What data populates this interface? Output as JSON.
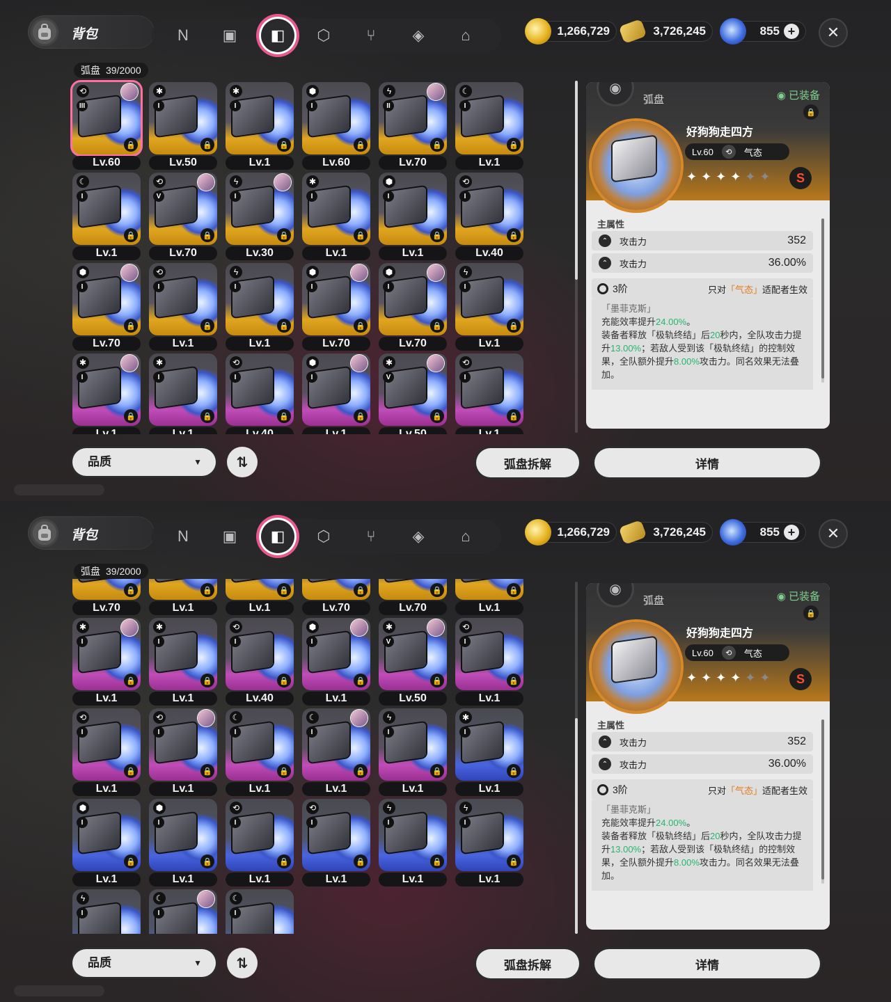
{
  "header": {
    "title": "背包",
    "nav_icons": [
      "n-logo-icon",
      "gameboy-icon",
      "disc-drive-icon",
      "cube-icon",
      "utensils-icon",
      "book-icon",
      "home-icon"
    ],
    "active_index": 2
  },
  "currencies": [
    {
      "name": "gold-coin-icon",
      "value": "1,266,729"
    },
    {
      "name": "ticket-icon",
      "value": "3,726,245"
    },
    {
      "name": "polychrome-icon",
      "value": "855"
    }
  ],
  "inventory": {
    "label": "弧盘",
    "count": "39/2000"
  },
  "panel1": {
    "cards": [
      {
        "lv": "Lv.60",
        "rank": "III",
        "frame": "gold",
        "attr": "⟲",
        "avatar": true,
        "selected": true
      },
      {
        "lv": "Lv.50",
        "rank": "I",
        "frame": "gold",
        "attr": "✱",
        "avatar": false
      },
      {
        "lv": "Lv.1",
        "rank": "I",
        "frame": "gold",
        "attr": "✱",
        "avatar": false
      },
      {
        "lv": "Lv.60",
        "rank": "I",
        "frame": "gold",
        "attr": "⬢",
        "avatar": false
      },
      {
        "lv": "Lv.70",
        "rank": "II",
        "frame": "gold",
        "attr": "ϟ",
        "avatar": true
      },
      {
        "lv": "Lv.1",
        "rank": "I",
        "frame": "gold",
        "attr": "☾",
        "avatar": false
      },
      {
        "lv": "Lv.1",
        "rank": "I",
        "frame": "gold",
        "attr": "☾",
        "avatar": false
      },
      {
        "lv": "Lv.70",
        "rank": "V",
        "frame": "gold",
        "attr": "⟲",
        "avatar": true
      },
      {
        "lv": "Lv.30",
        "rank": "I",
        "frame": "gold",
        "attr": "ϟ",
        "avatar": true
      },
      {
        "lv": "Lv.1",
        "rank": "I",
        "frame": "gold",
        "attr": "✱",
        "avatar": false
      },
      {
        "lv": "Lv.1",
        "rank": "I",
        "frame": "gold",
        "attr": "⬢",
        "avatar": false
      },
      {
        "lv": "Lv.40",
        "rank": "I",
        "frame": "gold",
        "attr": "⟲",
        "avatar": false
      },
      {
        "lv": "Lv.70",
        "rank": "I",
        "frame": "gold",
        "attr": "⬢",
        "avatar": true
      },
      {
        "lv": "Lv.1",
        "rank": "I",
        "frame": "gold",
        "attr": "⟲",
        "avatar": false
      },
      {
        "lv": "Lv.1",
        "rank": "I",
        "frame": "gold",
        "attr": "ϟ",
        "avatar": false
      },
      {
        "lv": "Lv.70",
        "rank": "I",
        "frame": "gold",
        "attr": "⬢",
        "avatar": true
      },
      {
        "lv": "Lv.70",
        "rank": "I",
        "frame": "gold",
        "attr": "⬢",
        "avatar": true
      },
      {
        "lv": "Lv.1",
        "rank": "I",
        "frame": "gold",
        "attr": "ϟ",
        "avatar": false
      },
      {
        "lv": "Lv.1",
        "rank": "I",
        "frame": "purple",
        "attr": "✱",
        "avatar": true
      },
      {
        "lv": "Lv.1",
        "rank": "I",
        "frame": "purple",
        "attr": "✱",
        "avatar": false
      },
      {
        "lv": "Lv.40",
        "rank": "I",
        "frame": "purple",
        "attr": "⟲",
        "avatar": false
      },
      {
        "lv": "Lv.1",
        "rank": "I",
        "frame": "purple",
        "attr": "⬢",
        "avatar": true
      },
      {
        "lv": "Lv.50",
        "rank": "V",
        "frame": "purple",
        "attr": "✱",
        "avatar": true
      },
      {
        "lv": "Lv.1",
        "rank": "I",
        "frame": "purple",
        "attr": "⟲",
        "avatar": false
      }
    ]
  },
  "panel2": {
    "cards": [
      {
        "lv": "Lv.70",
        "rank": "I",
        "frame": "gold",
        "attr": "⬢",
        "avatar": false
      },
      {
        "lv": "Lv.1",
        "rank": "I",
        "frame": "gold",
        "attr": "⟲",
        "avatar": false
      },
      {
        "lv": "Lv.1",
        "rank": "I",
        "frame": "gold",
        "attr": "ϟ",
        "avatar": false
      },
      {
        "lv": "Lv.70",
        "rank": "I",
        "frame": "gold",
        "attr": "⬢",
        "avatar": false
      },
      {
        "lv": "Lv.70",
        "rank": "I",
        "frame": "gold",
        "attr": "⬢",
        "avatar": false
      },
      {
        "lv": "Lv.1",
        "rank": "I",
        "frame": "gold",
        "attr": "ϟ",
        "avatar": false
      },
      {
        "lv": "Lv.1",
        "rank": "I",
        "frame": "purple",
        "attr": "✱",
        "avatar": true
      },
      {
        "lv": "Lv.1",
        "rank": "I",
        "frame": "purple",
        "attr": "✱",
        "avatar": false
      },
      {
        "lv": "Lv.40",
        "rank": "I",
        "frame": "purple",
        "attr": "⟲",
        "avatar": false
      },
      {
        "lv": "Lv.1",
        "rank": "I",
        "frame": "purple",
        "attr": "⬢",
        "avatar": true
      },
      {
        "lv": "Lv.50",
        "rank": "V",
        "frame": "purple",
        "attr": "✱",
        "avatar": true
      },
      {
        "lv": "Lv.1",
        "rank": "I",
        "frame": "purple",
        "attr": "⟲",
        "avatar": false
      },
      {
        "lv": "Lv.1",
        "rank": "I",
        "frame": "purple",
        "attr": "⟲",
        "avatar": false
      },
      {
        "lv": "Lv.1",
        "rank": "I",
        "frame": "purple",
        "attr": "⟲",
        "avatar": true
      },
      {
        "lv": "Lv.1",
        "rank": "I",
        "frame": "purple",
        "attr": "☾",
        "avatar": false
      },
      {
        "lv": "Lv.1",
        "rank": "I",
        "frame": "purple",
        "attr": "☾",
        "avatar": true
      },
      {
        "lv": "Lv.1",
        "rank": "I",
        "frame": "purple",
        "attr": "ϟ",
        "avatar": false
      },
      {
        "lv": "Lv.1",
        "rank": "I",
        "frame": "blue",
        "attr": "✱",
        "avatar": false
      },
      {
        "lv": "Lv.1",
        "rank": "I",
        "frame": "blue",
        "attr": "⬢",
        "avatar": false
      },
      {
        "lv": "Lv.1",
        "rank": "I",
        "frame": "blue",
        "attr": "⬢",
        "avatar": false
      },
      {
        "lv": "Lv.1",
        "rank": "I",
        "frame": "blue",
        "attr": "⟲",
        "avatar": false
      },
      {
        "lv": "Lv.1",
        "rank": "I",
        "frame": "blue",
        "attr": "⟲",
        "avatar": false
      },
      {
        "lv": "Lv.1",
        "rank": "I",
        "frame": "blue",
        "attr": "ϟ",
        "avatar": false
      },
      {
        "lv": "Lv.1",
        "rank": "I",
        "frame": "blue",
        "attr": "ϟ",
        "avatar": false
      },
      {
        "lv": "",
        "rank": "I",
        "frame": "blue",
        "attr": "ϟ",
        "avatar": false
      },
      {
        "lv": "",
        "rank": "I",
        "frame": "blue",
        "attr": "☾",
        "avatar": true
      },
      {
        "lv": "",
        "rank": "I",
        "frame": "blue",
        "attr": "☾",
        "avatar": false
      }
    ]
  },
  "controls": {
    "sort_label": "品质",
    "dismantle_label": "弧盘拆解",
    "details_label": "详情"
  },
  "detail": {
    "category": "弧盘",
    "equipped": "已装备",
    "name": "好狗狗走四方",
    "level": "Lv.60",
    "attribute": "气态",
    "stars_filled": 4,
    "stars_total": 6,
    "rarity": "S",
    "main_stats_title": "主属性",
    "stats": [
      {
        "name": "攻击力",
        "value": "352"
      },
      {
        "name": "攻击力",
        "value": "36.00%"
      }
    ],
    "set_tier": "3阶",
    "set_only_prefix": "只对",
    "set_only_attr": "「气态」",
    "set_only_suffix": "适配者生效",
    "set_name": "「墨菲克斯」",
    "desc_1a": "充能效率提升",
    "desc_1b": "24.00%",
    "desc_1c": "。",
    "desc_2a": "装备者释放「极轨终结」后",
    "desc_2b": "20",
    "desc_2c": "秒内，全队攻击力提升",
    "desc_2d": "13.00%",
    "desc_2e": "；若敌人受到该「极轨终结」的控制效果，全队额外提升",
    "desc_2f": "8.00%",
    "desc_2g": "攻击力。同名效果无法叠加。"
  },
  "colors": {
    "accent_pink": "#e8588f",
    "gold_frame": "#d9a21e",
    "purple_frame": "#b64fb3",
    "blue_frame": "#3d5ad6",
    "green_text": "#25b56f",
    "orange_text": "#e47a1c"
  }
}
